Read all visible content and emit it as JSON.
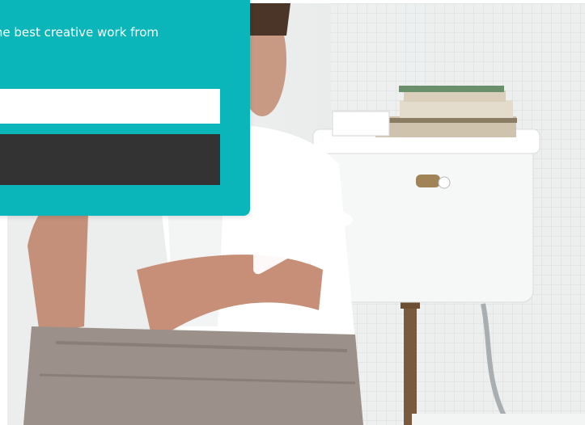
{
  "signup": {
    "text": "the best creative work from",
    "email_value": "",
    "button_label": ""
  },
  "video": {
    "play_icon": "play-icon"
  },
  "colors": {
    "card_background": "#0ab6b9",
    "button_background": "#333333",
    "input_background": "#ffffff"
  }
}
